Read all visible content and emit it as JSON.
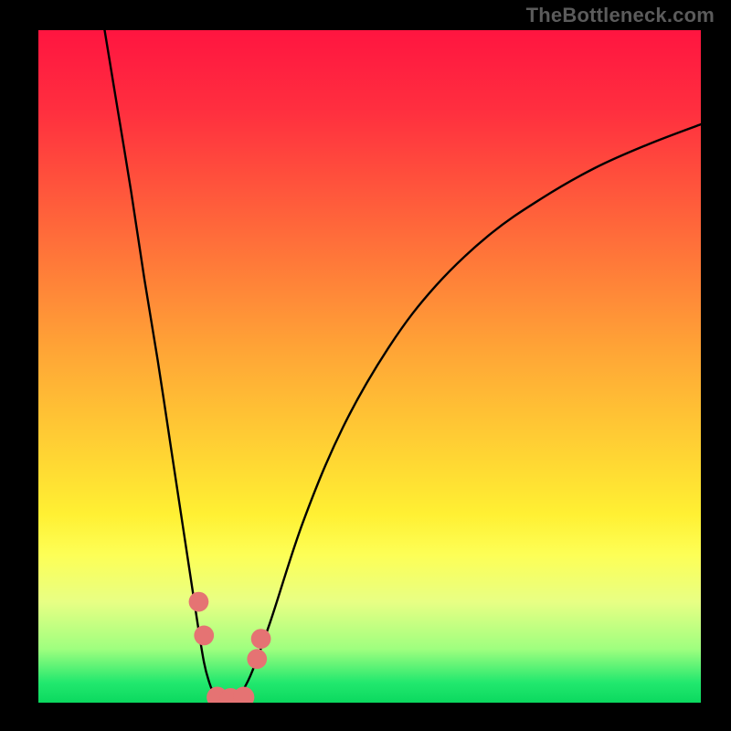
{
  "attribution": "TheBottleneck.com",
  "chart_data": {
    "type": "line",
    "title": "",
    "xlabel": "",
    "ylabel": "",
    "xlim": [
      0,
      100
    ],
    "ylim": [
      0,
      100
    ],
    "background": {
      "type": "vertical-gradient",
      "stops": [
        {
          "pos": 0,
          "color": "#ff1540"
        },
        {
          "pos": 12,
          "color": "#ff2f3f"
        },
        {
          "pos": 30,
          "color": "#ff6a3a"
        },
        {
          "pos": 48,
          "color": "#ffa636"
        },
        {
          "pos": 64,
          "color": "#ffd733"
        },
        {
          "pos": 72,
          "color": "#fff033"
        },
        {
          "pos": 78,
          "color": "#fdff56"
        },
        {
          "pos": 85,
          "color": "#e8ff84"
        },
        {
          "pos": 92,
          "color": "#9fff7f"
        },
        {
          "pos": 97,
          "color": "#22e86e"
        },
        {
          "pos": 100,
          "color": "#0bd95f"
        }
      ]
    },
    "series": [
      {
        "name": "curve-left",
        "color": "#000000",
        "x": [
          10,
          12,
          14,
          16,
          18,
          20,
          22,
          24,
          25,
          25.8,
          26.4,
          27
        ],
        "y": [
          100,
          88,
          76,
          63,
          51,
          38,
          25,
          12,
          6,
          3,
          1.5,
          0.5
        ]
      },
      {
        "name": "curve-right",
        "color": "#000000",
        "x": [
          30,
          32,
          35,
          40,
          46,
          53,
          60,
          68,
          76,
          84,
          92,
          100
        ],
        "y": [
          0.5,
          4,
          12,
          27,
          41,
          53,
          62,
          69.5,
          75,
          79.5,
          83,
          86
        ]
      }
    ],
    "markers": [
      {
        "name": "blob-left-1",
        "x": 24.2,
        "y": 15.0,
        "r": 1.5,
        "color": "#e57373"
      },
      {
        "name": "blob-left-2",
        "x": 25.0,
        "y": 10.0,
        "r": 1.5,
        "color": "#e57373"
      },
      {
        "name": "blob-bottom-1",
        "x": 27.0,
        "y": 0.8,
        "r": 1.6,
        "color": "#e57373"
      },
      {
        "name": "blob-bottom-2",
        "x": 29.0,
        "y": 0.6,
        "r": 1.6,
        "color": "#e57373"
      },
      {
        "name": "blob-bottom-3",
        "x": 31.0,
        "y": 0.8,
        "r": 1.6,
        "color": "#e57373"
      },
      {
        "name": "blob-right-1",
        "x": 33.0,
        "y": 6.5,
        "r": 1.5,
        "color": "#e57373"
      },
      {
        "name": "blob-right-2",
        "x": 33.6,
        "y": 9.5,
        "r": 1.5,
        "color": "#e57373"
      }
    ]
  }
}
